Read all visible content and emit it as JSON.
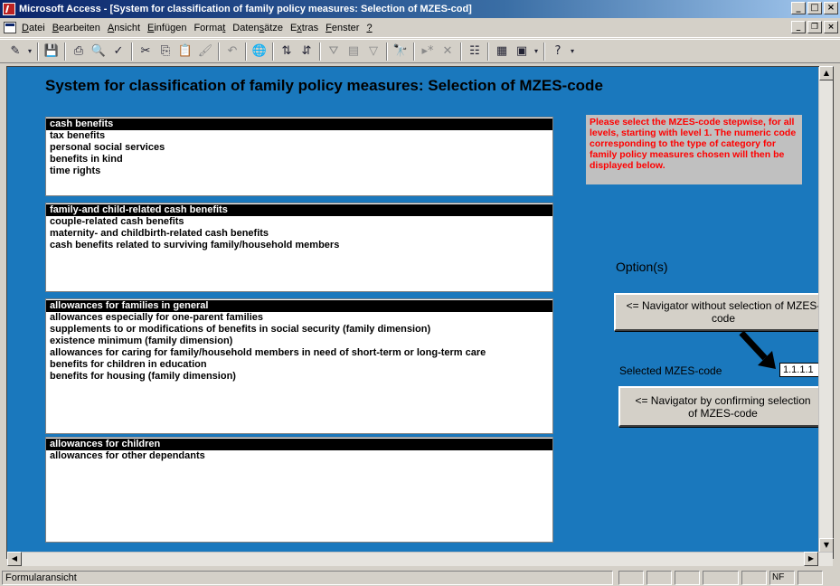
{
  "window": {
    "title": "Microsoft Access - [System for classification of family policy measures: Selection of MZES-cod]"
  },
  "menu": [
    {
      "label": "Datei",
      "key": "D"
    },
    {
      "label": "Bearbeiten",
      "key": "B"
    },
    {
      "label": "Ansicht",
      "key": "A"
    },
    {
      "label": "Einfügen",
      "key": "E"
    },
    {
      "label": "Format",
      "key": "t"
    },
    {
      "label": "Datensätze",
      "key": "s"
    },
    {
      "label": "Extras",
      "key": "x"
    },
    {
      "label": "Fenster",
      "key": "F"
    },
    {
      "label": "?",
      "key": "?"
    }
  ],
  "form": {
    "title": "System for classification of family policy measures: Selection of MZES-code",
    "level1": [
      "cash benefits",
      "tax benefits",
      "personal social services",
      "benefits in kind",
      "time rights"
    ],
    "level2": [
      "family-and child-related cash benefits",
      "couple-related cash benefits",
      "maternity- and childbirth-related cash benefits",
      "cash benefits related to surviving family/household members"
    ],
    "level3": [
      "allowances for families in general",
      "allowances especially for one-parent families",
      "supplements to or modifications of benefits in social security (family dimension)",
      "existence minimum (family dimension)",
      "allowances for caring for family/household members in need of short-term or long-term care",
      "benefits for children in education",
      "benefits for housing (family dimension)"
    ],
    "level4": [
      "allowances for children",
      "allowances for other dependants"
    ],
    "info_text": "Please select the MZES-code stepwise, for all levels, starting with level 1. The numeric code corresponding to the type of category for family policy measures chosen will then be displayed below.",
    "options_label": "Option(s)",
    "nav_without_label": "<= Navigator without selection of MZES-code",
    "selected_label": "Selected MZES-code",
    "selected_value": "1.1.1.1",
    "nav_confirm_label": "<= Navigator by confirming selection of MZES-code"
  },
  "status": {
    "text": "Formularansicht",
    "nf": "NF"
  }
}
